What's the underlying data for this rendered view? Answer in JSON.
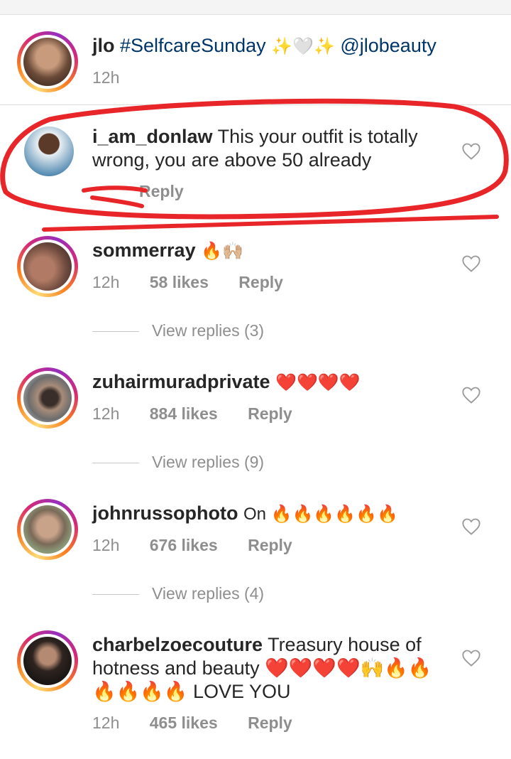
{
  "caption": {
    "username": "jlo",
    "hashtag": "#SelfcareSunday",
    "emojis": "✨🤍✨",
    "mention": "@jlobeauty",
    "time": "12h"
  },
  "comments": [
    {
      "username": "i_am_donlaw",
      "text": "This your outfit is totally wrong, you are above 50 already",
      "time": "",
      "likes": "",
      "reply": "Reply"
    },
    {
      "username": "sommerray",
      "text": "🔥🙌🏼",
      "time": "12h",
      "likes": "58 likes",
      "reply": "Reply",
      "view_replies": "View replies (3)"
    },
    {
      "username": "zuhairmuradprivate",
      "text": "❤️❤️❤️❤️",
      "time": "12h",
      "likes": "884 likes",
      "reply": "Reply",
      "view_replies": "View replies (9)"
    },
    {
      "username": "johnrussophoto",
      "text": "On 🔥🔥🔥🔥🔥🔥",
      "time": "12h",
      "likes": "676 likes",
      "reply": "Reply",
      "view_replies": "View replies (4)"
    },
    {
      "username": "charbelzoecouture",
      "text": "Treasury house of hotness and beauty ❤️❤️❤️❤️🙌🔥🔥 🔥🔥🔥🔥 LOVE YOU",
      "time": "12h",
      "likes": "465 likes",
      "reply": "Reply"
    }
  ],
  "colors": {
    "link": "#003569",
    "meta": "#8e8e8e",
    "annotation": "#e8262a"
  },
  "icons": [
    "heart-outline-icon"
  ]
}
